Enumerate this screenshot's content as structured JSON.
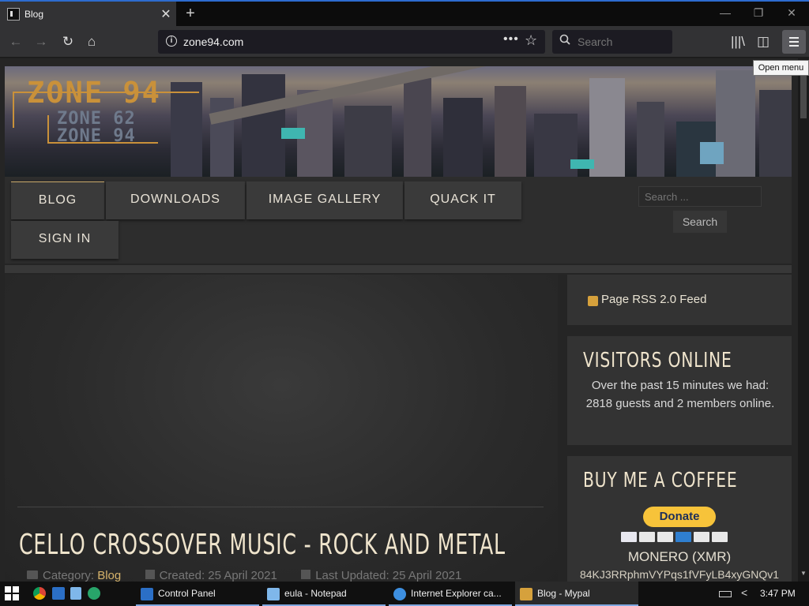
{
  "browser": {
    "tab_title": "Blog",
    "url": "zone94.com",
    "search_placeholder": "Search",
    "tooltip": "Open menu"
  },
  "site": {
    "logo_main": "ZONE 94",
    "logo_sub1": "ZONE 62",
    "logo_sub2": "ZONE 94",
    "nav": [
      "BLOG",
      "DOWNLOADS",
      "IMAGE GALLERY",
      "QUACK IT",
      "SIGN IN"
    ],
    "search_placeholder": "Search ...",
    "search_button": "Search"
  },
  "post": {
    "title": "CELLO CROSSOVER MUSIC - ROCK AND METAL",
    "category_label": "Category:",
    "category_value": "Blog",
    "created": "Created: 25 April 2021",
    "updated": "Last Updated: 25 April 2021"
  },
  "sidebar": {
    "rss": "Page RSS 2.0 Feed",
    "visitors_title": "VISITORS ONLINE",
    "visitors_text": "Over the past 15 minutes we had: 2818 guests and 2 members online.",
    "coffee_title": "BUY ME A COFFEE",
    "donate": "Donate",
    "monero": "MONERO (XMR)",
    "xmr_address": "84KJ3RRphmVYPqs1fVFyLB4xyGNQv1"
  },
  "taskbar": {
    "apps": [
      "Control Panel",
      "eula - Notepad",
      "Internet Explorer ca...",
      "Blog - Mypal"
    ],
    "time": "3:47 PM"
  },
  "colors": {
    "accent_gold": "#c9913a",
    "title_cream": "#efe4cc",
    "donate_yellow": "#f7c33a"
  }
}
